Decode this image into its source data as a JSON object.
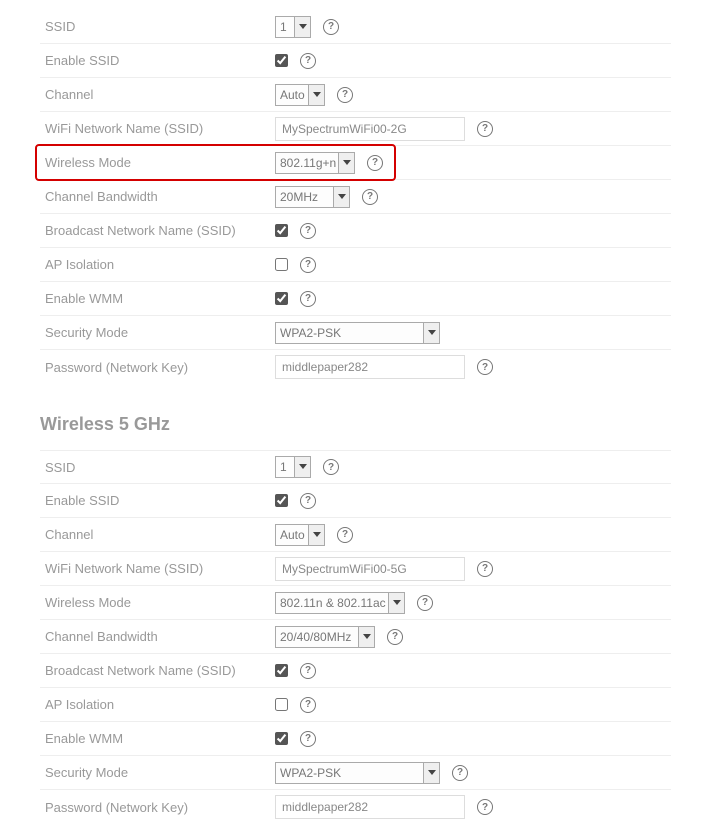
{
  "g24": {
    "ssid_label": "SSID",
    "ssid_val": "1",
    "enable_ssid_label": "Enable SSID",
    "enable_ssid_checked": true,
    "channel_label": "Channel",
    "channel_val": "Auto",
    "name_label": "WiFi Network Name (SSID)",
    "name_val": "MySpectrumWiFi00-2G",
    "mode_label": "Wireless Mode",
    "mode_val": "802.11g+n",
    "bw_label": "Channel Bandwidth",
    "bw_val": "20MHz",
    "broadcast_label": "Broadcast Network Name (SSID)",
    "broadcast_checked": true,
    "ap_iso_label": "AP Isolation",
    "ap_iso_checked": false,
    "wmm_label": "Enable WMM",
    "wmm_checked": true,
    "sec_label": "Security Mode",
    "sec_val": "WPA2-PSK",
    "pw_label": "Password (Network Key)",
    "pw_val": "middlepaper282"
  },
  "section5_title": "Wireless 5 GHz",
  "g5": {
    "ssid_label": "SSID",
    "ssid_val": "1",
    "enable_ssid_label": "Enable SSID",
    "enable_ssid_checked": true,
    "channel_label": "Channel",
    "channel_val": "Auto",
    "name_label": "WiFi Network Name (SSID)",
    "name_val": "MySpectrumWiFi00-5G",
    "mode_label": "Wireless Mode",
    "mode_val": "802.11n & 802.11ac",
    "bw_label": "Channel Bandwidth",
    "bw_val": "20/40/80MHz",
    "broadcast_label": "Broadcast Network Name (SSID)",
    "broadcast_checked": true,
    "ap_iso_label": "AP Isolation",
    "ap_iso_checked": false,
    "wmm_label": "Enable WMM",
    "wmm_checked": true,
    "sec_label": "Security Mode",
    "sec_val": "WPA2-PSK",
    "pw_label": "Password (Network Key)",
    "pw_val": "middlepaper282"
  }
}
